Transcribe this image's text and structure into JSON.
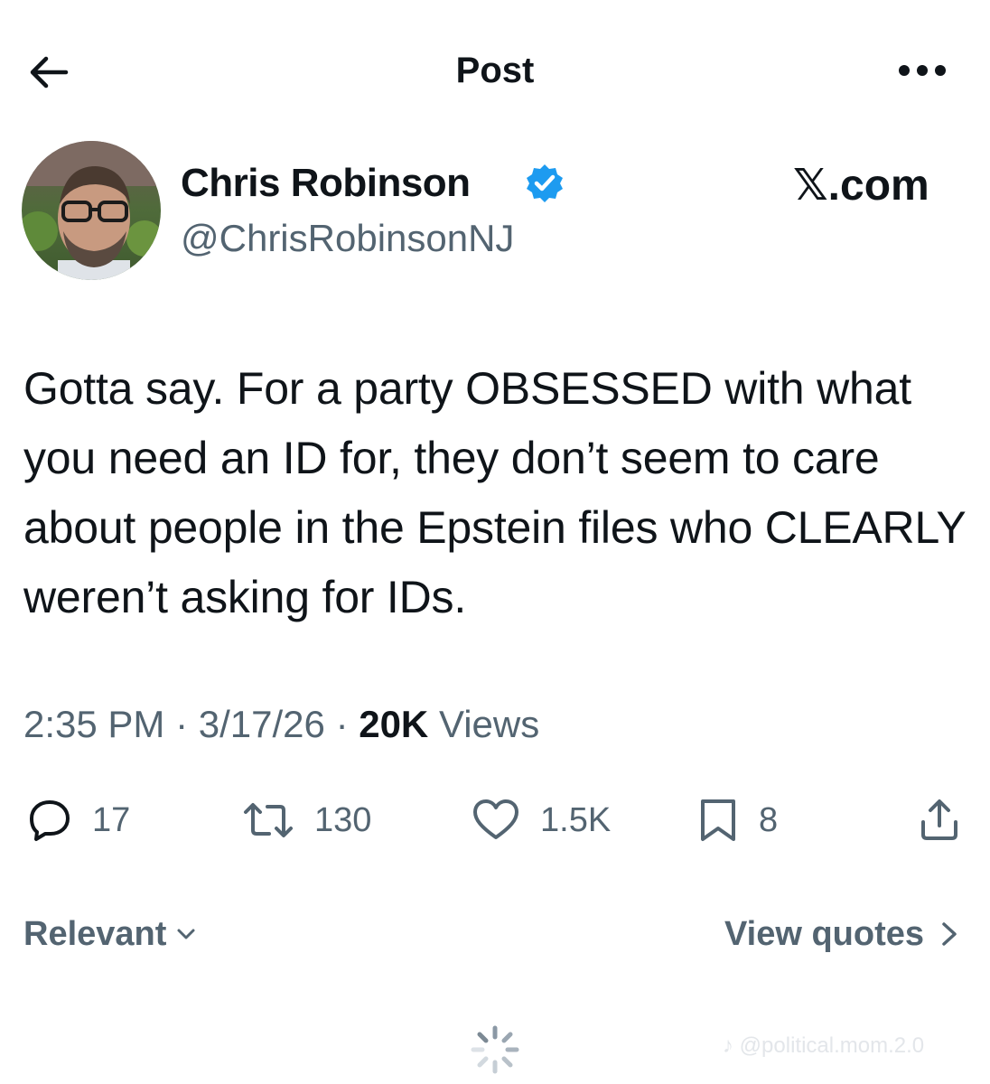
{
  "header": {
    "title": "Post",
    "back_icon": "arrow-left-icon",
    "more_icon": "more-horizontal-icon"
  },
  "author": {
    "display_name": "Chris Robinson",
    "handle": "@ChrisRobinsonNJ",
    "verified": true,
    "verified_color": "#1d9bf0",
    "avatar_icon": "profile-photo"
  },
  "brand": {
    "label": "𝕏.com"
  },
  "post": {
    "text": "Gotta say. For a party OBSESSED with what you need an ID for, they don’t seem to care about people in the Epstein files who CLEARLY weren’t asking for IDs.",
    "time": "2:35 PM",
    "date": "3/17/26",
    "views_count": "20K",
    "views_label": "Views"
  },
  "actions": {
    "replies": "17",
    "reposts": "130",
    "likes": "1.5K",
    "bookmarks": "8"
  },
  "sort": {
    "label": "Relevant"
  },
  "quotes": {
    "label": "View quotes"
  },
  "watermark": {
    "text": "@political.mom.2.0"
  },
  "colors": {
    "text_primary": "#0f1419",
    "text_secondary": "#536471",
    "accent": "#1d9bf0"
  }
}
